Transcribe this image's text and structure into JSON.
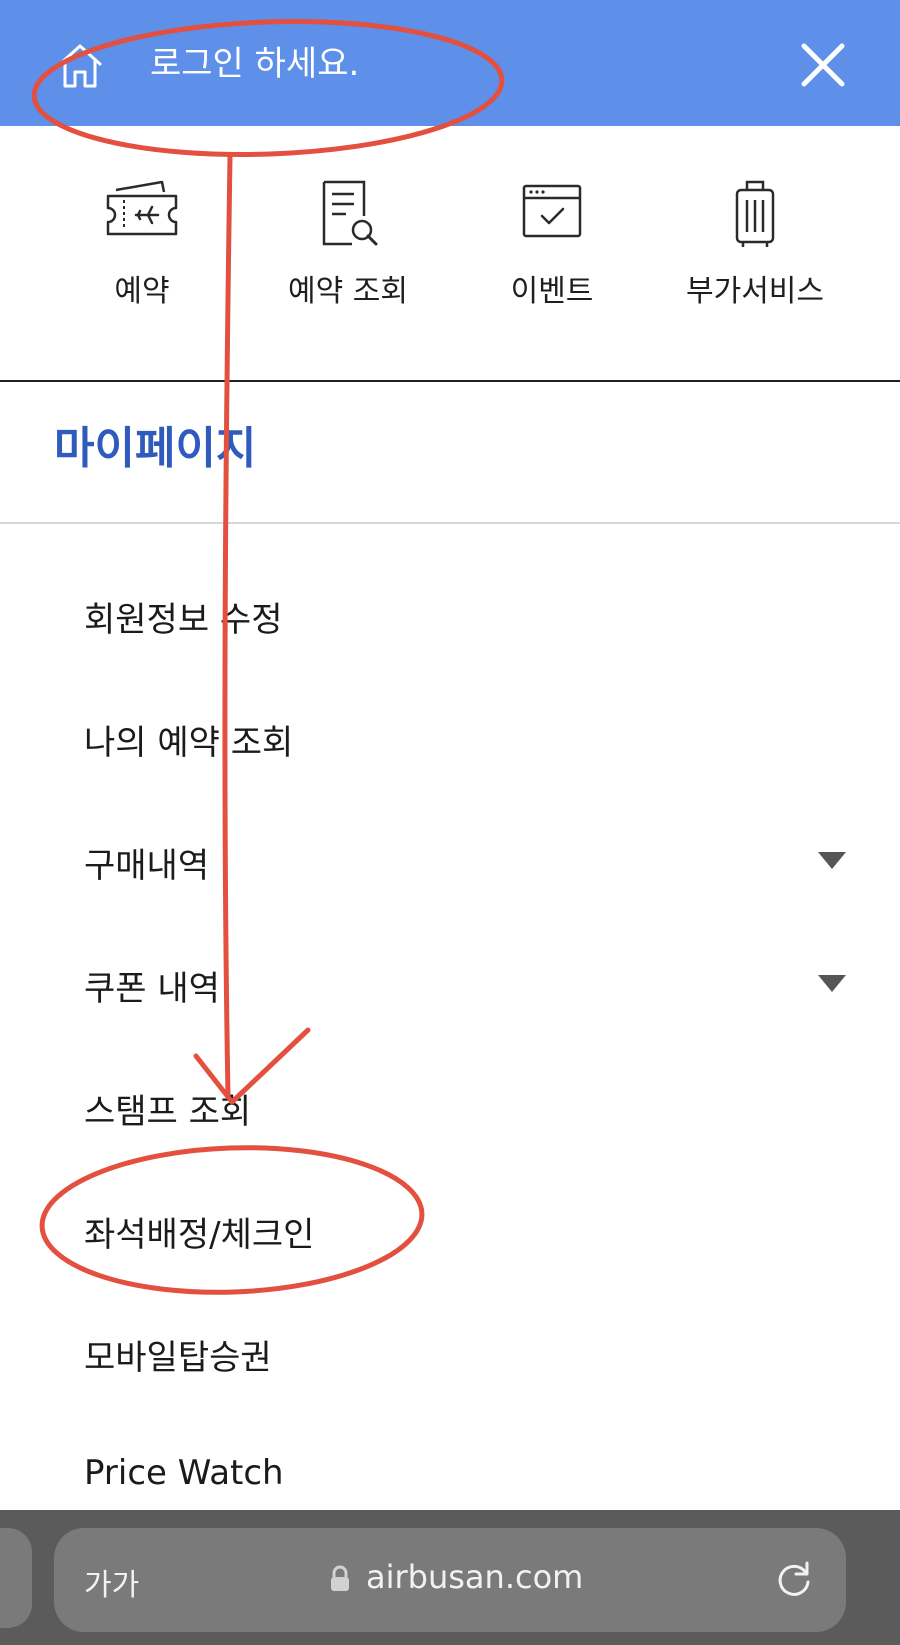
{
  "header": {
    "home_icon": "home-icon",
    "login_text": "로그인 하세요.",
    "close_icon": "close-icon",
    "bg_color": "#5e8fe9"
  },
  "quick_menu": [
    {
      "label": "예약",
      "icon": "plane-ticket-icon"
    },
    {
      "label": "예약 조회",
      "icon": "document-search-icon"
    },
    {
      "label": "이벤트",
      "icon": "calendar-check-icon"
    },
    {
      "label": "부가서비스",
      "icon": "luggage-icon"
    }
  ],
  "mypage": {
    "title": "마이페이지",
    "title_color": "#2f5bbf",
    "items": [
      {
        "label": "회원정보 수정"
      },
      {
        "label": "나의 예약 조회"
      },
      {
        "label": "구매내역",
        "expandable": true
      },
      {
        "label": "쿠폰 내역",
        "expandable": true
      },
      {
        "label": "스탬프 조회"
      },
      {
        "label": "좌석배정/체크인"
      },
      {
        "label": "모바일탑승권"
      },
      {
        "label": "Price Watch"
      }
    ]
  },
  "browser": {
    "text_size_label": "가가",
    "url": "airbusan.com",
    "lock_icon": "lock-icon",
    "reload_icon": "reload-icon"
  },
  "annotation": {
    "color": "#e3503f"
  }
}
